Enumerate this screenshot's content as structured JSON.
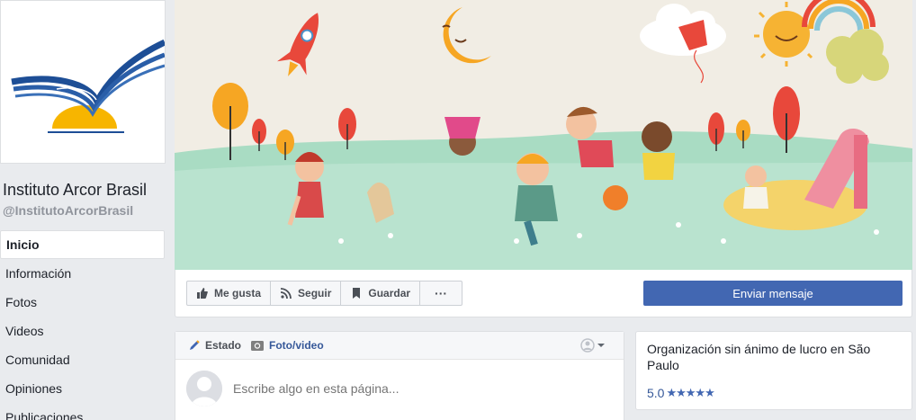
{
  "page": {
    "name": "Instituto Arcor Brasil",
    "handle": "@InstitutoArcorBrasil"
  },
  "nav": {
    "items": [
      {
        "label": "Inicio",
        "active": true
      },
      {
        "label": "Información"
      },
      {
        "label": "Fotos"
      },
      {
        "label": "Videos"
      },
      {
        "label": "Comunidad"
      },
      {
        "label": "Opiniones"
      },
      {
        "label": "Publicaciones"
      }
    ]
  },
  "actions": {
    "like": "Me gusta",
    "follow": "Seguir",
    "save": "Guardar",
    "more": "···",
    "send_message": "Enviar mensaje"
  },
  "composer": {
    "tab_status": "Estado",
    "tab_photo": "Foto/video",
    "placeholder": "Escribe algo en esta página..."
  },
  "about": {
    "category": "Organización sin ánimo de lucro en São Paulo",
    "rating": "5.0",
    "stars": "★★★★★"
  },
  "colors": {
    "fb_blue": "#4267b2",
    "link_blue": "#365899",
    "background": "#e9ebee"
  }
}
